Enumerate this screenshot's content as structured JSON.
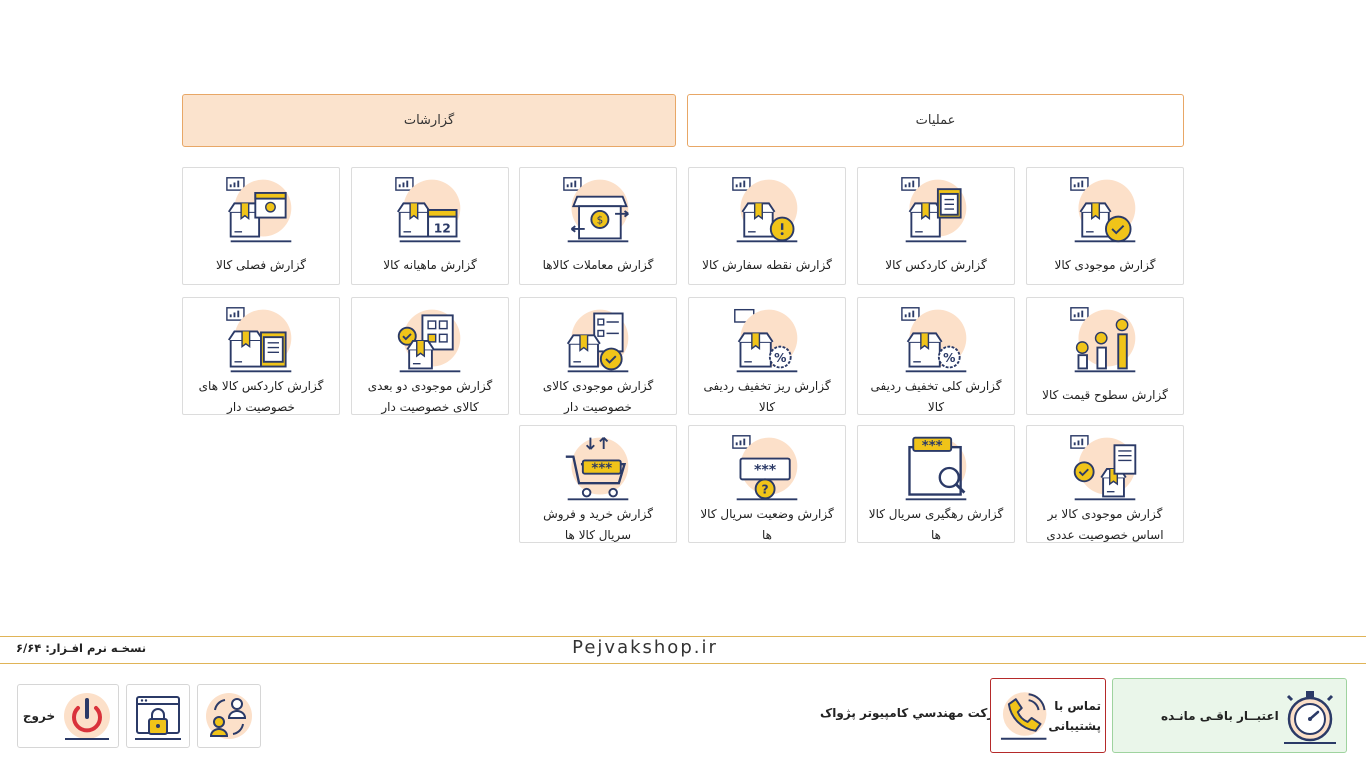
{
  "tabs": {
    "operations": "عملیات",
    "reports": "گزارشات"
  },
  "tiles": [
    "گزارش موجودی کالا",
    "گزارش کاردکس کالا",
    "گزارش نقطه سفارش کالا",
    "گزارش معاملات کالاها",
    "گزارش ماهیانه کالا",
    "گزارش فصلی کالا",
    "گزارش سطوح قیمت کالا",
    "گزارش کلی تخفیف ردیفی کالا",
    "گزارش ریز تخفیف ردیفی کالا",
    "گزارش موجودی کالای خصوصیت دار",
    "گزارش موجودی دو بعدی کالای خصوصیت دار",
    "گزارش کاردکس کالا های خصوصیت دار",
    "گزارش موجودی کالا بر اساس خصوصیت عددی",
    "گزارش رهگیری سریال کالا ها",
    "گزارش وضعیت سریال کالا ها",
    "گزارش خرید و فروش سریال کالا ها"
  ],
  "icons": [
    "box-check-icon",
    "box-clipboard-icon",
    "box-alert-icon",
    "store-exchange-icon",
    "box-calendar-icon",
    "box-season-calendar-icon",
    "price-levels-icon",
    "box-discount-icon",
    "box-discount-list-icon",
    "box-checklist-icon",
    "box-grid-check-icon",
    "box-clipboard-list-icon",
    "box-document-check-icon",
    "serial-search-icon",
    "serial-question-icon",
    "cart-serial-icon"
  ],
  "calendar_day": "12",
  "footer": {
    "version": "نسخـه نرم افـزار: ۶/۶۴",
    "brand": "Pejvakshop.ir",
    "credit": "اعتبــار باقـی مانـده",
    "support_line1": "تماس با",
    "support_line2": "پشتیبانی",
    "company": "شرکت مهندسي کامپيوتر پژواک",
    "exit": "خروج"
  },
  "colors": {
    "accent": "#e8a766",
    "active_tab": "#fbe3cd",
    "icon_circle": "#fce0c9",
    "icon_navy": "#2b3a67",
    "icon_yellow": "#f0c419",
    "credit_bg": "#eaf6ea",
    "support_border": "#b52a2a"
  }
}
